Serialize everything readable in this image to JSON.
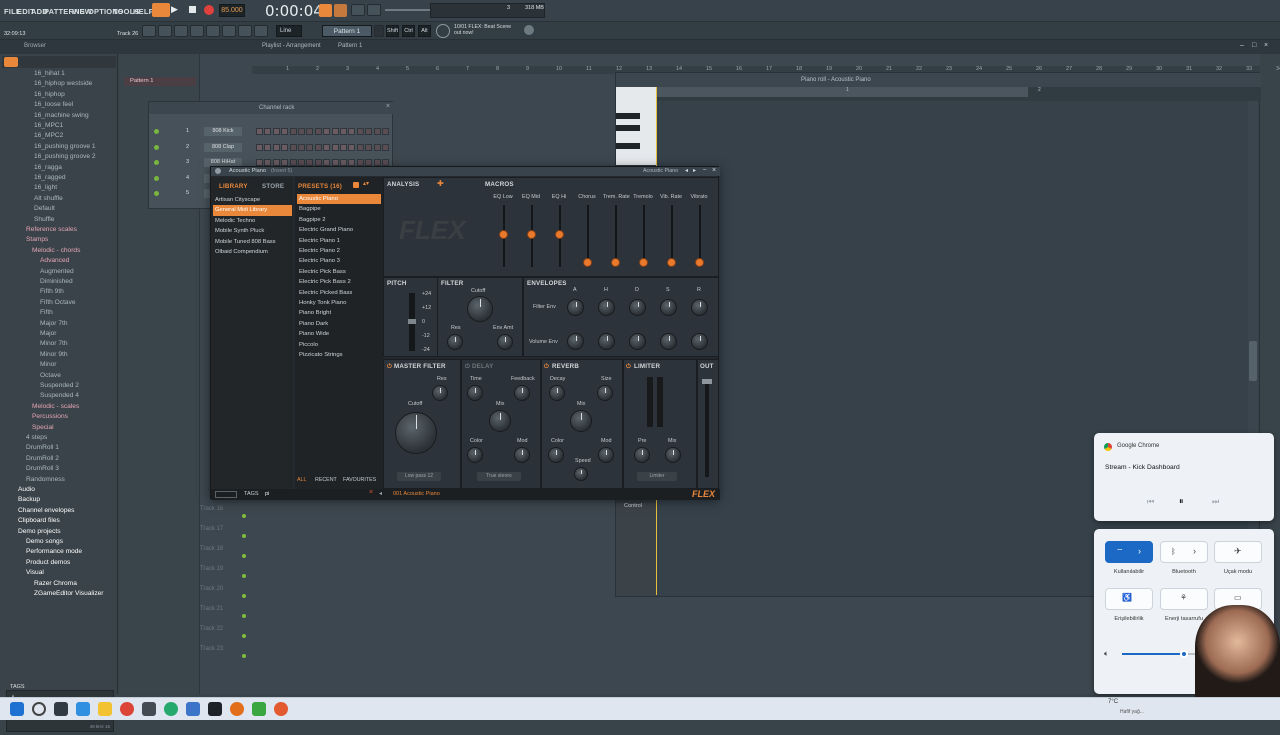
{
  "menu": [
    "FILE",
    "EDIT",
    "ADD",
    "PATTERNS",
    "VIEW",
    "OPTIONS",
    "TOOLS",
    "HELP"
  ],
  "transport": {
    "tempo": "85.000",
    "time": "0:00:04",
    "time_sub": "M:S:CS"
  },
  "hint": {
    "line1": "10/01  FLEX: Beat Scene",
    "line2": "out now!"
  },
  "toolbar": {
    "track": "Track 26",
    "cpu_time": "32:09:13",
    "mode": "Line",
    "pattern": "Pattern 1",
    "snap_btns": [
      "Shift",
      "Ctrl",
      "Alt"
    ],
    "mem": "318 MB",
    "voices": "3"
  },
  "browser": {
    "title": "Browser",
    "items": [
      {
        "label": "16_hihat 1",
        "cls": "dim",
        "indent": 34
      },
      {
        "label": "16_hiphop westside",
        "cls": "dim",
        "indent": 34
      },
      {
        "label": "16_hiphop",
        "cls": "dim",
        "indent": 34
      },
      {
        "label": "16_loose feel",
        "cls": "dim",
        "indent": 34
      },
      {
        "label": "16_machine swing",
        "cls": "dim",
        "indent": 34
      },
      {
        "label": "16_MPC1",
        "cls": "dim",
        "indent": 34
      },
      {
        "label": "16_MPC2",
        "cls": "dim",
        "indent": 34
      },
      {
        "label": "16_pushing groove 1",
        "cls": "dim",
        "indent": 34
      },
      {
        "label": "16_pushing groove 2",
        "cls": "dim",
        "indent": 34
      },
      {
        "label": "16_ragga",
        "cls": "dim",
        "indent": 34
      },
      {
        "label": "16_ragged",
        "cls": "dim",
        "indent": 34
      },
      {
        "label": "16_light",
        "cls": "dim",
        "indent": 34
      },
      {
        "label": "Alt shuffle",
        "cls": "dim",
        "indent": 34
      },
      {
        "label": "Default",
        "cls": "dim",
        "indent": 34
      },
      {
        "label": "Shuffle",
        "cls": "dim",
        "indent": 34
      },
      {
        "label": "Reference scales",
        "cls": "pink",
        "indent": 26
      },
      {
        "label": "Stamps",
        "cls": "pink",
        "indent": 26
      },
      {
        "label": "Melodic - chords",
        "cls": "pink",
        "indent": 32
      },
      {
        "label": "Advanced",
        "cls": "pink",
        "indent": 40
      },
      {
        "label": "Augmented",
        "cls": "dim",
        "indent": 40
      },
      {
        "label": "Diminished",
        "cls": "dim",
        "indent": 40
      },
      {
        "label": "Fifth 9th",
        "cls": "dim",
        "indent": 40
      },
      {
        "label": "Fifth Octave",
        "cls": "dim",
        "indent": 40
      },
      {
        "label": "Fifth",
        "cls": "dim",
        "indent": 40
      },
      {
        "label": "Major 7th",
        "cls": "dim",
        "indent": 40
      },
      {
        "label": "Major",
        "cls": "dim",
        "indent": 40
      },
      {
        "label": "Minor 7th",
        "cls": "dim",
        "indent": 40
      },
      {
        "label": "Minor 9th",
        "cls": "dim",
        "indent": 40
      },
      {
        "label": "Minor",
        "cls": "dim",
        "indent": 40
      },
      {
        "label": "Octave",
        "cls": "dim",
        "indent": 40
      },
      {
        "label": "Suspended 2",
        "cls": "dim",
        "indent": 40
      },
      {
        "label": "Suspended 4",
        "cls": "dim",
        "indent": 40
      },
      {
        "label": "Melodic - scales",
        "cls": "pink",
        "indent": 32
      },
      {
        "label": "Percussions",
        "cls": "pink",
        "indent": 32
      },
      {
        "label": "Special",
        "cls": "pink",
        "indent": 32
      },
      {
        "label": "4 steps",
        "cls": "dim",
        "indent": 26
      },
      {
        "label": "DrumRoll 1",
        "cls": "dim",
        "indent": 26
      },
      {
        "label": "DrumRoll 2",
        "cls": "dim",
        "indent": 26
      },
      {
        "label": "DrumRoll 3",
        "cls": "dim",
        "indent": 26
      },
      {
        "label": "Randomness",
        "cls": "dim",
        "indent": 26
      },
      {
        "label": "Audio",
        "cls": "folder",
        "indent": 18
      },
      {
        "label": "Backup",
        "cls": "folder",
        "indent": 18
      },
      {
        "label": "Channel envelopes",
        "cls": "folder",
        "indent": 18
      },
      {
        "label": "Clipboard files",
        "cls": "folder",
        "indent": 18
      },
      {
        "label": "Demo projects",
        "cls": "folder",
        "indent": 18
      },
      {
        "label": "Demo songs",
        "cls": "folder",
        "indent": 26
      },
      {
        "label": "Performance mode",
        "cls": "folder",
        "indent": 26
      },
      {
        "label": "Product demos",
        "cls": "folder",
        "indent": 26
      },
      {
        "label": "Visual",
        "cls": "folder",
        "indent": 26
      },
      {
        "label": "Razer Chroma",
        "cls": "folder",
        "indent": 34
      },
      {
        "label": "ZGameEditor Visualizer",
        "cls": "folder",
        "indent": 34
      }
    ],
    "footer": "TAGS",
    "wave_info": "48 kHz 16"
  },
  "playlist": {
    "title": "Playlist - Arrangement",
    "pattern_crumb": "Pattern 1",
    "pattern_item": "Pattern 1",
    "tracks": [
      "Track 16",
      "Track 17",
      "Track 18",
      "Track 19",
      "Track 20",
      "Track 21",
      "Track 22",
      "Track 23"
    ],
    "bar_numbers": [
      "1",
      "2",
      "3",
      "4",
      "5",
      "6",
      "7",
      "8",
      "9",
      "10",
      "11",
      "12",
      "13",
      "14",
      "15",
      "16",
      "17",
      "18",
      "19",
      "20",
      "21",
      "22",
      "23",
      "24",
      "25",
      "26",
      "27",
      "28",
      "29",
      "30",
      "31",
      "32",
      "33",
      "34"
    ]
  },
  "channel_rack": {
    "title": "Channel rack",
    "channels": [
      {
        "num": "1",
        "name": "808 Kick"
      },
      {
        "num": "2",
        "name": "808 Clap"
      },
      {
        "num": "3",
        "name": "808 HiHat"
      },
      {
        "num": "4",
        "name": ""
      },
      {
        "num": "5",
        "name": ""
      }
    ]
  },
  "piano_roll": {
    "title": "Piano roll - Acoustic Piano",
    "bar1": "1",
    "bar2": "2",
    "control": "Control"
  },
  "flex": {
    "title": "Acoustic Piano",
    "title_sub": "(Insert 5)",
    "right_title": "Acoustic Piano",
    "tabs": {
      "library": "LIBRARY",
      "store": "STORE",
      "presets": "PRESETS (16)",
      "analysis": "ANALYSIS",
      "macros": "MACROS"
    },
    "libraries": [
      "Artisan Cityscape",
      "General Midi Library",
      "Melodic Techno",
      "Mobile Synth Pluck",
      "Mobile Tuned 808 Bass",
      "Olbaid Compendium"
    ],
    "presets": [
      "Acoustic Piano",
      "Bagpipe",
      "Bagpipe 2",
      "Electric Grand Piano",
      "Electric Piano 1",
      "Electric Piano 2",
      "Electric Piano 3",
      "Electric Pick Bass",
      "Electric Pick Bass 2",
      "Electric Picked Bass",
      "Honky Tonk Piano",
      "Piano Bright",
      "Piano Dark",
      "Piano Wide",
      "Piccolo",
      "Pizzicato Strings"
    ],
    "macros": [
      "EQ Low",
      "EQ Mid",
      "EQ Hi",
      "Chorus",
      "Trem. Rate",
      "Tremolo",
      "Vib. Rate",
      "Vibrato"
    ],
    "pitch": {
      "title": "PITCH",
      "marks": [
        "+24",
        "+12",
        "0",
        "-12",
        "-24"
      ]
    },
    "filter": {
      "title": "FILTER",
      "cutoff": "Cutoff",
      "res": "Res",
      "envamt": "Env Amt"
    },
    "envelopes": {
      "title": "ENVELOPES",
      "cols": [
        "A",
        "H",
        "D",
        "S",
        "R"
      ],
      "row1": "Filter Env",
      "row2": "Volume Env"
    },
    "master_filter": {
      "title": "MASTER FILTER",
      "cutoff": "Cutoff",
      "res": "Res",
      "btn": "Low pass 12"
    },
    "delay": {
      "title": "DELAY",
      "time": "Time",
      "feedback": "Feedback",
      "mix": "Mix",
      "color": "Color",
      "mod": "Mod",
      "btn": "True stereo"
    },
    "reverb": {
      "title": "REVERB",
      "decay": "Decay",
      "size": "Size",
      "mix": "Mix",
      "color": "Color",
      "mod": "Mod",
      "speed": "Speed"
    },
    "limiter": {
      "title": "LIMITER",
      "pre": "Pre",
      "mix": "Mix",
      "btn": "Limiter"
    },
    "out": "OUT",
    "footer": {
      "all": "ALL",
      "recent": "RECENT",
      "favourites": "FAVOURITES",
      "tags": "TAGS",
      "search": "pi",
      "preset": "001 Acoustic Piano",
      "logo": "FLEX"
    },
    "watermark": "FLEX"
  },
  "media_flyout": {
    "app": "Google Chrome",
    "title": "Stream - Kick Dashboard"
  },
  "quick_settings": {
    "wifi": "Kullanılabilir",
    "bluetooth": "Bluetooth",
    "airplane": "Uçak modu",
    "access": "Erişilebilirlik",
    "energy": "Enerji tasarrufu"
  },
  "taskbar": {
    "weather": "7°C",
    "weather_sub": "Hafif yağ..."
  }
}
